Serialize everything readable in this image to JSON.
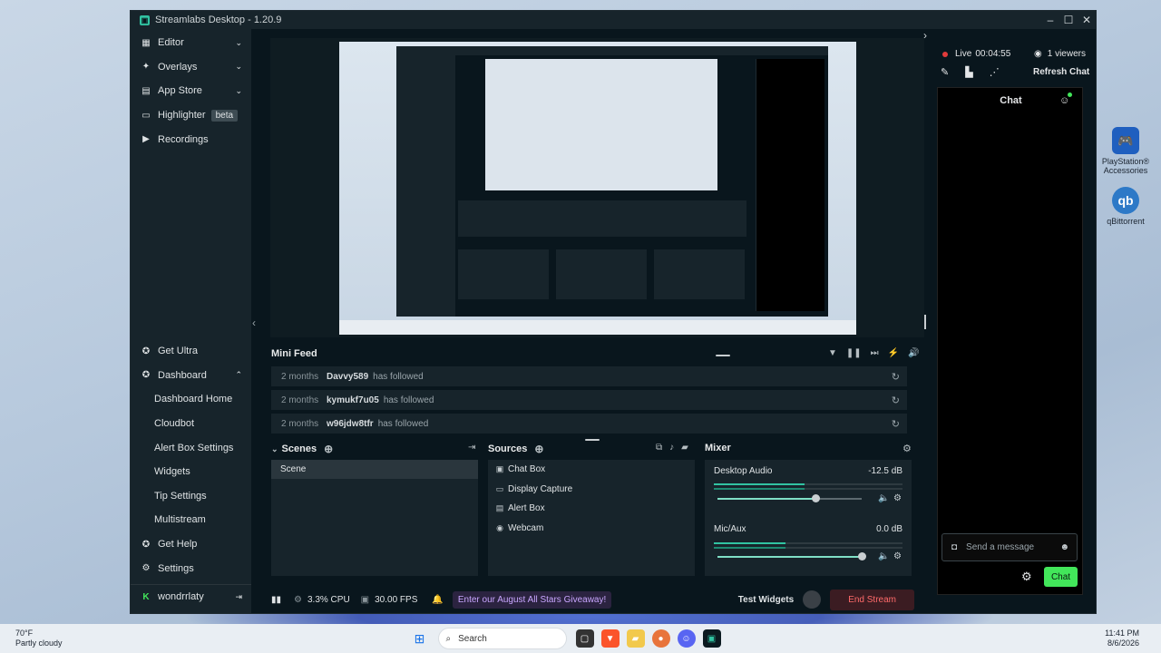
{
  "app": {
    "title": "Streamlabs Desktop - 1.20.9",
    "minimize_glyph": "–",
    "maximize_glyph": "☐",
    "close_glyph": "✕"
  },
  "sidebar": {
    "items": [
      {
        "label": "Editor",
        "icon": "editor-icon",
        "has_chevron": true
      },
      {
        "label": "Overlays",
        "icon": "overlays-icon",
        "has_chevron": true
      },
      {
        "label": "App Store",
        "icon": "store-icon",
        "has_chevron": true
      },
      {
        "label": "Highlighter",
        "icon": "highlighter-icon",
        "badge": "beta"
      },
      {
        "label": "Recordings",
        "icon": "recordings-icon"
      }
    ],
    "bottom_items": [
      {
        "label": "Get Ultra",
        "icon": "ultra-icon"
      },
      {
        "label": "Dashboard",
        "icon": "dashboard-icon",
        "expanded": true
      },
      {
        "label": "Dashboard Home",
        "sub": true
      },
      {
        "label": "Cloudbot",
        "sub": true
      },
      {
        "label": "Alert Box Settings",
        "sub": true
      },
      {
        "label": "Widgets",
        "sub": true
      },
      {
        "label": "Tip Settings",
        "sub": true
      },
      {
        "label": "Multistream",
        "sub": true
      },
      {
        "label": "Get Help",
        "icon": "help-icon"
      },
      {
        "label": "Settings",
        "icon": "settings-icon"
      }
    ],
    "user": "wondrrlaty"
  },
  "mini_feed": {
    "title": "Mini Feed",
    "rows": [
      {
        "age": "2 months",
        "name": "Davvy589",
        "action": "has followed"
      },
      {
        "age": "2 months",
        "name": "kymukf7u05",
        "action": "has followed"
      },
      {
        "age": "2 months",
        "name": "w96jdw8tfr",
        "action": "has followed"
      }
    ]
  },
  "scenes": {
    "title": "Scenes",
    "items": [
      "Scene"
    ]
  },
  "sources": {
    "title": "Sources",
    "items": [
      {
        "label": "Chat Box",
        "icon": "chat-icon"
      },
      {
        "label": "Display Capture",
        "icon": "monitor-icon"
      },
      {
        "label": "Alert Box",
        "icon": "alert-icon"
      },
      {
        "label": "Webcam",
        "icon": "webcam-icon"
      }
    ]
  },
  "mixer": {
    "title": "Mixer",
    "channels": [
      {
        "name": "Desktop Audio",
        "db": "-12.5 dB",
        "level": 0.68
      },
      {
        "name": "Mic/Aux",
        "db": "0.0 dB",
        "level": 1.0
      }
    ]
  },
  "footer": {
    "cpu": "3.3% CPU",
    "fps": "30.00 FPS",
    "promo": "Enter our August All Stars Giveaway!",
    "test_widgets": "Test Widgets",
    "end_stream": "End Stream"
  },
  "right_panel": {
    "live_label": "Live",
    "live_time": "00:04:55",
    "viewers": "1 viewers",
    "refresh_chat": "Refresh Chat",
    "chat_title": "Chat",
    "chat_placeholder": "Send a message",
    "chat_button": "Chat"
  },
  "desktop_icons": [
    {
      "label": "PlayStation® Accessories",
      "color": "#1f5fbf"
    },
    {
      "label": "qBittorrent",
      "color": "#2d79c7"
    }
  ],
  "taskbar": {
    "weather_temp": "70°F",
    "weather_desc": "Partly cloudy",
    "search": "Search",
    "time": "11:41 PM",
    "date": "8/6/2026"
  },
  "colors": {
    "accent": "#31c3a2",
    "live_dot": "#e23b3b",
    "chat_button": "#42e65a",
    "end_stream": "#ff6a6a"
  }
}
